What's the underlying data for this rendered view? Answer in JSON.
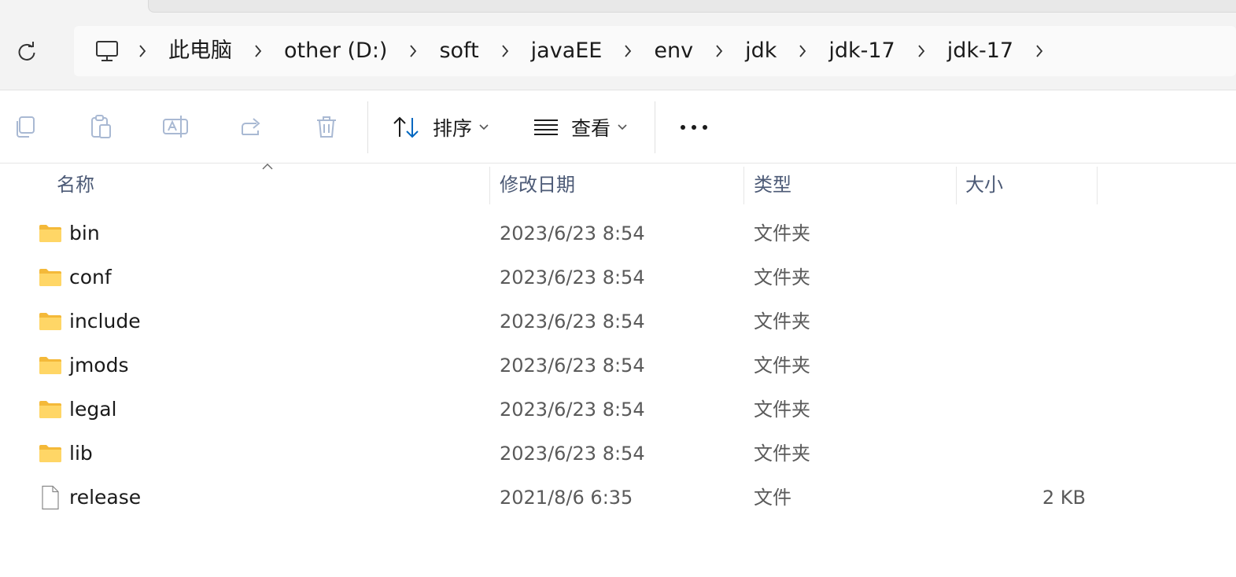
{
  "breadcrumb": {
    "items": [
      "此电脑",
      "other (D:)",
      "soft",
      "javaEE",
      "env",
      "jdk",
      "jdk-17",
      "jdk-17"
    ]
  },
  "toolbar": {
    "sort_label": "排序",
    "view_label": "查看"
  },
  "columns": {
    "name": "名称",
    "modified": "修改日期",
    "type": "类型",
    "size": "大小"
  },
  "files": [
    {
      "name": "bin",
      "modified": "2023/6/23 8:54",
      "type": "文件夹",
      "size": "",
      "kind": "folder"
    },
    {
      "name": "conf",
      "modified": "2023/6/23 8:54",
      "type": "文件夹",
      "size": "",
      "kind": "folder"
    },
    {
      "name": "include",
      "modified": "2023/6/23 8:54",
      "type": "文件夹",
      "size": "",
      "kind": "folder"
    },
    {
      "name": "jmods",
      "modified": "2023/6/23 8:54",
      "type": "文件夹",
      "size": "",
      "kind": "folder"
    },
    {
      "name": "legal",
      "modified": "2023/6/23 8:54",
      "type": "文件夹",
      "size": "",
      "kind": "folder"
    },
    {
      "name": "lib",
      "modified": "2023/6/23 8:54",
      "type": "文件夹",
      "size": "",
      "kind": "folder"
    },
    {
      "name": "release",
      "modified": "2021/8/6 6:35",
      "type": "文件",
      "size": "2 KB",
      "kind": "file"
    }
  ],
  "colors": {
    "folder": "#f7c948",
    "accent": "#0067c0"
  }
}
